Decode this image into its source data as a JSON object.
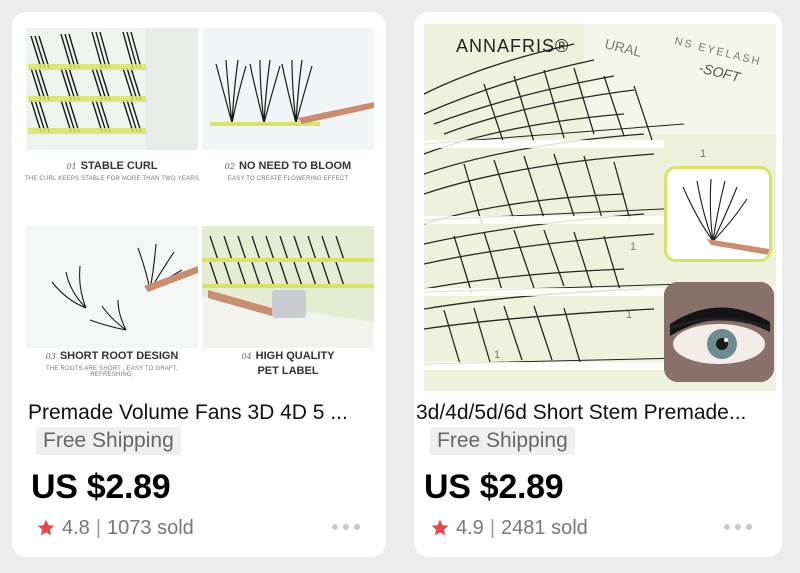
{
  "cards": [
    {
      "title": "Premade Volume Fans 3D 4D 5 ...",
      "shipping": "Free Shipping",
      "price": "US $2.89",
      "rating": "4.8",
      "sold": "1073 sold",
      "image": {
        "panels": [
          {
            "num": "01",
            "title": "STABLE CURL",
            "sub": "THE CURL KEEPS STABLE FOR MORE THAN TWO YEARS"
          },
          {
            "num": "02",
            "title": "NO NEED TO BLOOM",
            "sub": "EASY TO CREATE FLOWERING EFFECT"
          },
          {
            "num": "03",
            "title": "SHORT ROOT DESIGN",
            "sub": "THE ROOTS ARE SHORT , EASY TO GRAFT, REFRESHING,"
          },
          {
            "num": "04",
            "title": "HIGH QUALITY",
            "title2": "PET LABEL"
          }
        ]
      }
    },
    {
      "title": "3d/4d/5d/6d Short Stem Premade...",
      "shipping": "Free Shipping",
      "price": "US $2.89",
      "rating": "4.9",
      "sold": "2481 sold",
      "image": {
        "brand": "ANNAFRIS®",
        "label_fragments": [
          "URAL",
          "NS EYELASH",
          "-SOFT"
        ]
      }
    }
  ],
  "colors": {
    "star": "#e8474b",
    "accent_green": "#d6e36a",
    "rose_gold": "#c98d72"
  }
}
